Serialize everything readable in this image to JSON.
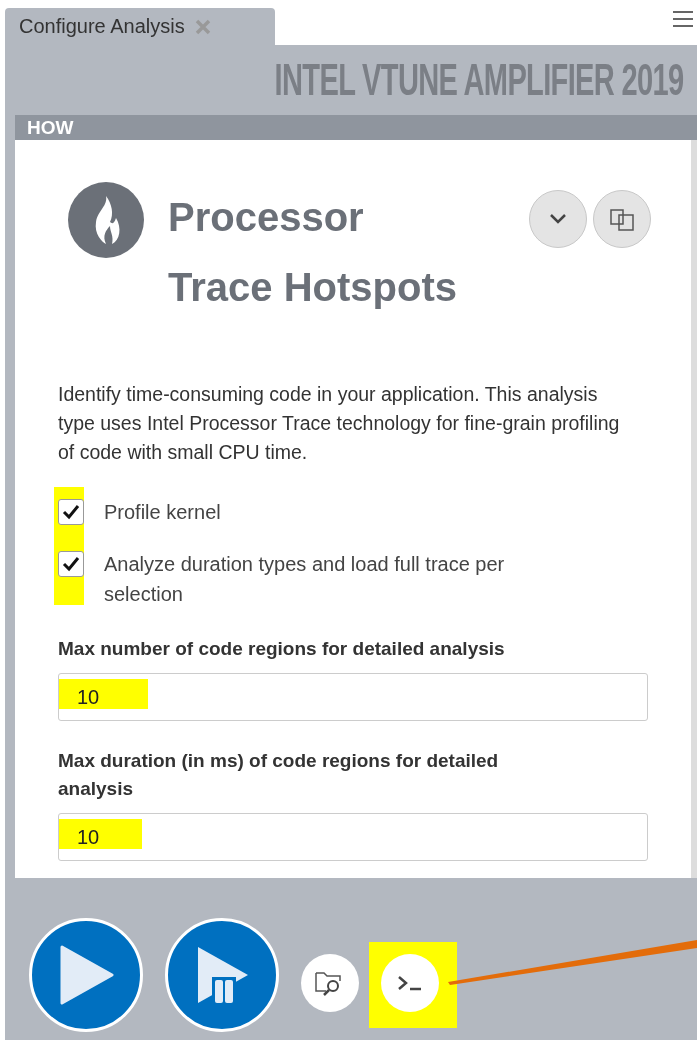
{
  "tab": {
    "label": "Configure Analysis",
    "selected": true
  },
  "banner": "INTEL VTUNE AMPLIFIER 2019",
  "section": "HOW",
  "analysis": {
    "title": "Processor Trace Hotspots",
    "description": "Identify time-consuming code in your application. This analysis type uses Intel Processor Trace technology for fine-grain profiling of code with small CPU time."
  },
  "options": [
    {
      "label": "Profile kernel",
      "checked": true
    },
    {
      "label": "Analyze duration types and load full trace per selection",
      "checked": true
    }
  ],
  "fields": [
    {
      "label": "Max number of code regions for detailed analysis",
      "value": "10"
    },
    {
      "label": "Max duration (in ms) of code regions for detailed analysis",
      "value": "10"
    }
  ]
}
